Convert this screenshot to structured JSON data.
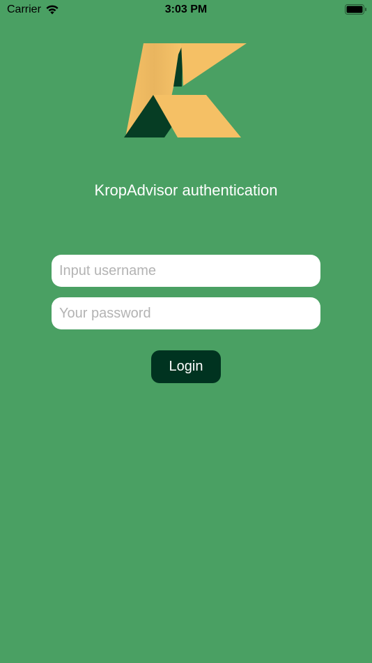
{
  "status_bar": {
    "carrier": "Carrier",
    "time": "3:03 PM",
    "wifi_icon": "wifi-icon",
    "battery_icon": "battery-icon"
  },
  "app": {
    "logo_icon": "krop-logo-icon",
    "title": "KropAdvisor authentication"
  },
  "form": {
    "username_placeholder": "Input username",
    "username_value": "",
    "password_placeholder": "Your password",
    "password_value": "",
    "login_label": "Login"
  },
  "colors": {
    "background": "#4aa063",
    "button": "#003320",
    "logo_gold": "#f5c065",
    "logo_dark": "#063d24"
  }
}
